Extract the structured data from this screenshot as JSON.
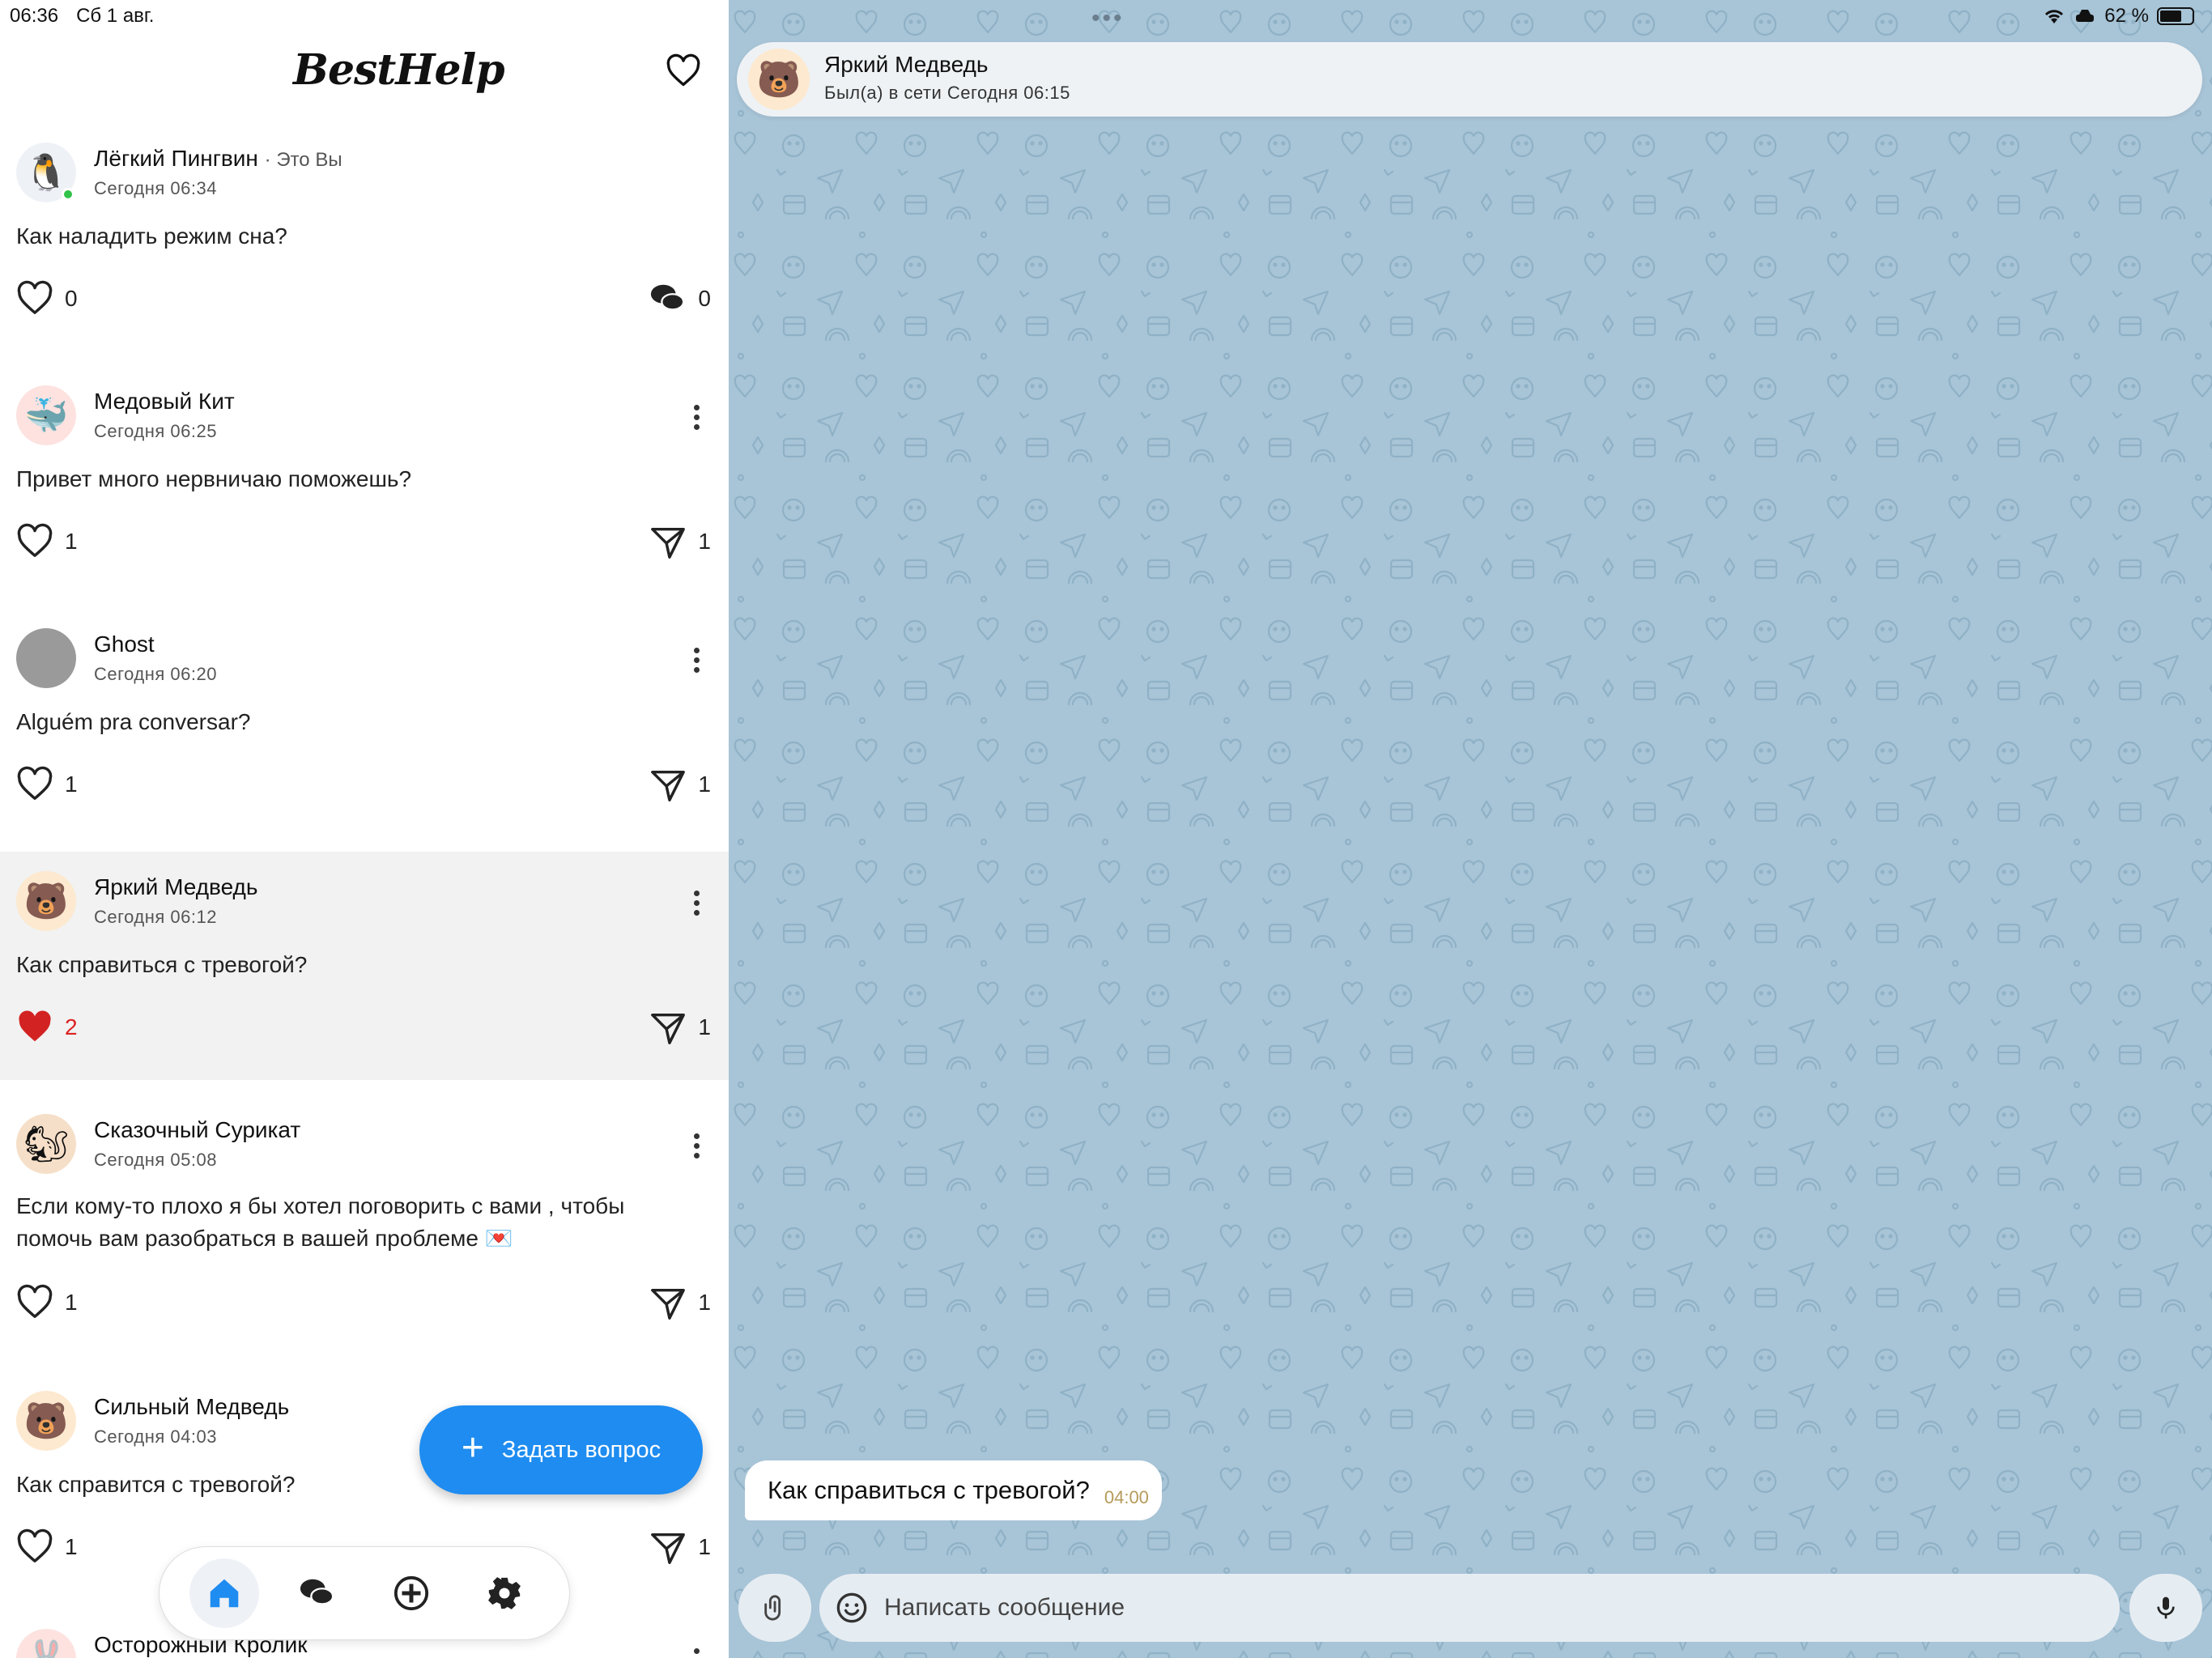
{
  "status": {
    "time": "06:36",
    "date": "Сб 1 авг.",
    "battery": "62 %"
  },
  "app": {
    "title": "BestHelp"
  },
  "fab_label": "Задать вопрос",
  "posts": [
    {
      "author": "Лёгкий Пингвин",
      "badge": "· Это Вы",
      "time": "Сегодня 06:34",
      "text": "Как наладить режим сна?",
      "likes": "0",
      "replies": "0",
      "avatar": "🐧"
    },
    {
      "author": "Медовый Кит",
      "time": "Сегодня 06:25",
      "text": "Привет много нервничаю поможешь?",
      "likes": "1",
      "shares": "1",
      "avatar": "🐳"
    },
    {
      "author": "Ghost",
      "time": "Сегодня 06:20",
      "text": "Alguém pra conversar?",
      "likes": "1",
      "shares": "1",
      "avatar": ""
    },
    {
      "author": "Яркий Медведь",
      "time": "Сегодня 06:12",
      "text": "Как справиться с тревогой?",
      "likes": "2",
      "shares": "1",
      "avatar": "🐻"
    },
    {
      "author": "Сказочный Сурикат",
      "time": "Сегодня 05:08",
      "text": "Если кому-то плохо я бы хотел поговорить с вами , чтобы помочь вам разобраться в вашей проблеме 💌",
      "likes": "1",
      "shares": "1",
      "avatar": "🐿"
    },
    {
      "author": "Сильный Медведь",
      "time": "Сегодня 04:03",
      "text": "Как справится с тревогой?",
      "likes": "1",
      "shares": "1",
      "avatar": "🐻"
    },
    {
      "author": "Осторожный Кролик",
      "avatar": "🐰"
    }
  ],
  "chat": {
    "name": "Яркий Медведь",
    "status": "Был(а) в сети Сегодня 06:15",
    "avatar": "🐻",
    "messages": [
      {
        "text": "Как справиться с тревогой?",
        "time": "04:00"
      }
    ],
    "input_placeholder": "Написать сообщение"
  },
  "colors": {
    "accent": "#1e8cf0",
    "liked": "#d22222",
    "chat_bg": "#a8c4d7",
    "highlight": "#f1f2f1"
  }
}
